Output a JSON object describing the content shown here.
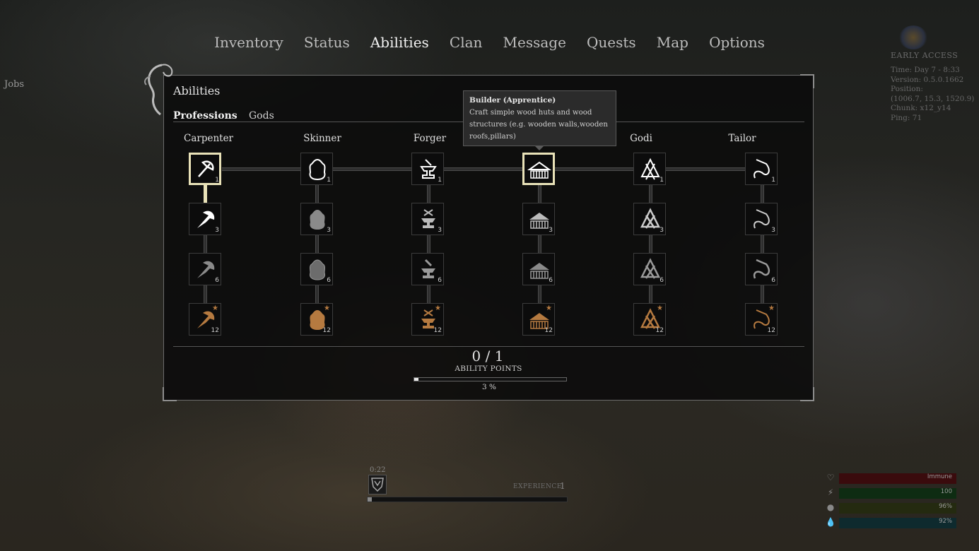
{
  "nav": {
    "items": [
      "Inventory",
      "Status",
      "Abilities",
      "Clan",
      "Message",
      "Quests",
      "Map",
      "Options"
    ],
    "active": "Abilities"
  },
  "jobs_label": "Jobs",
  "system": {
    "early_access": "EARLY ACCESS",
    "time": "Time: Day 7 - 8:33",
    "version": "Version: 0.5.0.1662",
    "position_label": "Position:",
    "position": "(1006.7, 15.3, 1520.9)",
    "chunk": "Chunk: x12_y14",
    "ping": "Ping: 71"
  },
  "panel": {
    "title": "Abilities",
    "tabs": [
      "Professions",
      "Gods"
    ],
    "active_tab": "Professions",
    "columns": [
      {
        "name": "Carpenter",
        "icon": "axe-icon",
        "levels": [
          "1",
          "3",
          "6",
          "12"
        ]
      },
      {
        "name": "Skinner",
        "icon": "hide-icon",
        "levels": [
          "1",
          "3",
          "6",
          "12"
        ]
      },
      {
        "name": "Forger",
        "icon": "anvil-icon",
        "levels": [
          "1",
          "3",
          "6",
          "12"
        ]
      },
      {
        "name": "Builder",
        "icon": "longhouse-icon",
        "levels": [
          "",
          "3",
          "6",
          "12"
        ]
      },
      {
        "name": "Godi",
        "icon": "valknut-icon",
        "levels": [
          "1",
          "3",
          "6",
          "12"
        ]
      },
      {
        "name": "Tailor",
        "icon": "needle-icon",
        "levels": [
          "1",
          "3",
          "6",
          "12"
        ]
      }
    ],
    "ability_points": {
      "value": "0 / 1",
      "label": "ABILITY POINTS",
      "percent": "3 %",
      "progress": 0.03
    }
  },
  "tooltip": {
    "title": "Builder (Apprentice)",
    "body": "Craft simple wood huts and wood structures (e.g. wooden walls,wooden roofs,pillars)"
  },
  "experience": {
    "timer": "0:22",
    "label": "EXPERIENCE",
    "level": "1",
    "progress": 0.02
  },
  "stats": [
    {
      "icon": "heart-icon",
      "value": "Immune",
      "color": "#3a0b0d"
    },
    {
      "icon": "stamina-icon",
      "value": "100",
      "color": "#0e2c12"
    },
    {
      "icon": "food-icon",
      "value": "96%",
      "color": "#242a10"
    },
    {
      "icon": "water-icon",
      "value": "92%",
      "color": "#0e2a2e"
    }
  ],
  "colors": {
    "selected": "#e9e2b8",
    "tier12": "#b57a40",
    "tier3": "#ffffff",
    "tier6": "#9a9a9a"
  }
}
